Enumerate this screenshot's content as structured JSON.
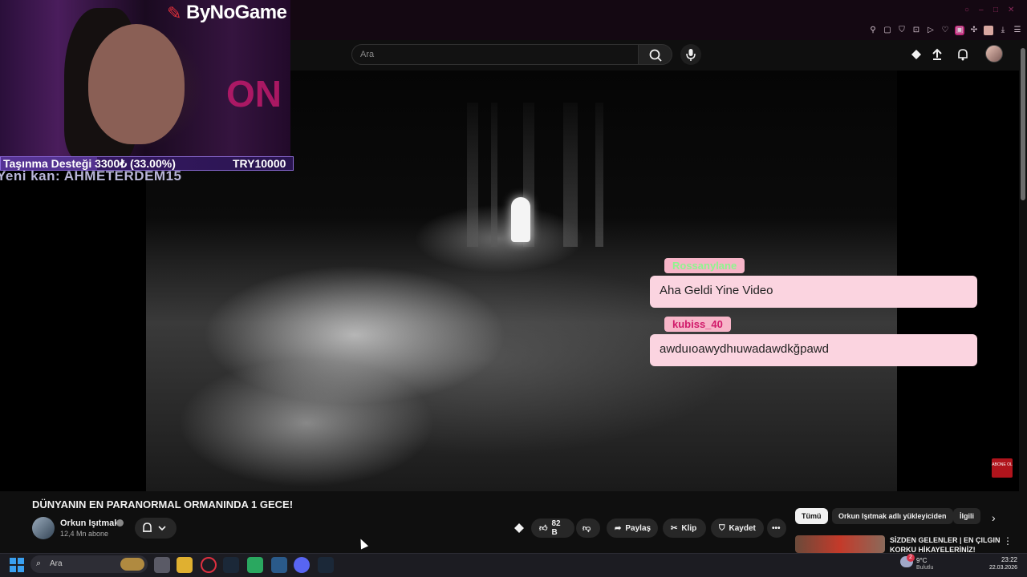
{
  "brand": {
    "logo_text": "ByNoGame"
  },
  "donation": {
    "label": "Taşınma Desteği 3300₺ (33.00%)",
    "target": "TRY10000",
    "progress_fraction": 0.33
  },
  "new_subscriber": {
    "text": "Yeni kan: AHMETERDEM15"
  },
  "webcam": {
    "neon_text": "ON"
  },
  "search": {
    "placeholder": "Ara"
  },
  "chat": [
    {
      "user": "Rossanylane",
      "message": "Aha Geldi Yine Video",
      "user_color": "#8ef58e"
    },
    {
      "user": "kubiss_40",
      "message": "awduıoawydhıuwadawdkğpawd",
      "user_color": "#d11a6a"
    }
  ],
  "subscribe_tag": {
    "text": "ABONE OL"
  },
  "video": {
    "title": "DÜNYANIN EN PARANORMAL ORMANINDA 1 GECE!",
    "channel_name": "Orkun Işıtmak",
    "subscribers": "12,4 Mn abone",
    "likes": "82 B",
    "share_label": "Paylaş",
    "clip_label": "Klip",
    "save_label": "Kaydet"
  },
  "recommendations": {
    "chips": [
      "Tümü",
      "Orkun Işıtmak adlı yükleyiciden",
      "İlgili"
    ],
    "first_title": "SİZDEN GELENLER | EN ÇILGIN KORKU HİKAYELERİNİZ!"
  },
  "taskbar": {
    "search_label": "Ara",
    "weather_temp": "9°C",
    "weather_desc": "Bulutlu",
    "time": "23:22",
    "date": "22.03.2026",
    "notification_count": "2"
  },
  "colors": {
    "accent_red": "#e0303a",
    "chat_bubble": "#fbd4e0",
    "chat_name_bg": "#f7b5c8"
  }
}
